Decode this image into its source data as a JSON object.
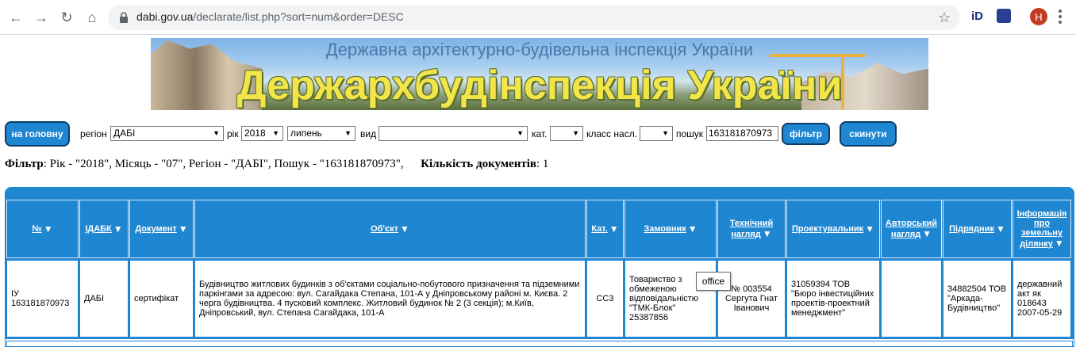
{
  "browser": {
    "url_host": "dabi.gov.ua",
    "url_path": "/declarate/list.php?sort=num&order=DESC",
    "profile_initial": "H"
  },
  "banner": {
    "subtitle": "Державна архітектурно-будівельна інспекція України",
    "title": "Держархбудінспекція України"
  },
  "toolbar": {
    "home_button": "на головну",
    "region_label": "регіон",
    "region_value": "ДАБІ",
    "year_label": "рік",
    "year_value": "2018",
    "month_value": "липень",
    "type_label": "вид",
    "type_value": "",
    "cat_label": "кат.",
    "cat_value": "",
    "class_label": "класс насл.",
    "class_value": "",
    "search_label": "пошук",
    "search_value": "163181870973",
    "filter_button": "фільтр",
    "reset_button": "скинути"
  },
  "summary": {
    "filter_label": "Фільтр",
    "filter_text": ": Рік - \"2018\", Місяць - \"07\", Регіон - \"ДАБІ\", Пошук - \"163181870973\",",
    "count_label": "Кількість документів",
    "count_value": ": 1"
  },
  "table": {
    "headers": [
      {
        "label": "№",
        "sort": true
      },
      {
        "label": "ІДАБК",
        "sort": true
      },
      {
        "label": "Документ",
        "sort": true
      },
      {
        "label": "Об'єкт",
        "sort": true
      },
      {
        "label": "Кат.",
        "sort": true
      },
      {
        "label": "Замовник",
        "sort": true
      },
      {
        "label": "Технічний нагляд",
        "sort": true
      },
      {
        "label": "Проектувальник",
        "sort": true
      },
      {
        "label": "Авторський нагляд",
        "sort": true
      },
      {
        "label": "Підрядник",
        "sort": true
      },
      {
        "label": "Інформація про земельну ділянку",
        "sort": true
      }
    ],
    "rows": [
      {
        "num": "ІУ 163181870973",
        "idabk": "ДАБІ",
        "document": "сертифікат",
        "object": "Будівництво житлових будинків з об'єктами соціально-побутового призначення та підземними паркінгами за адресою: вул. Сагайдака Степана, 101-А у Дніпровському районі м. Києва. 2 черга будівництва. 4 пусковий комплекс. Житловий будинок № 2 (3 секція); м.Київ, Дніпровський, вул. Степана Сагайдака, 101-А",
        "category": "СС3",
        "customer": "Товариство з обмеженою відповідальністю \"ТМК-Блок\" 25387856",
        "tech_supervision": "№ 003554 Сергута Гнат Іванович",
        "designer": "31059394 ТОВ \"Бюро інвестиційних проектів-проектний менеджмент\"",
        "author_supervision": "",
        "contractor": "34882504 ТОВ \"Аркада-Будівництво\"",
        "land_info": "державний акт як 018643 2007-05-29"
      }
    ]
  },
  "tooltip": "office"
}
